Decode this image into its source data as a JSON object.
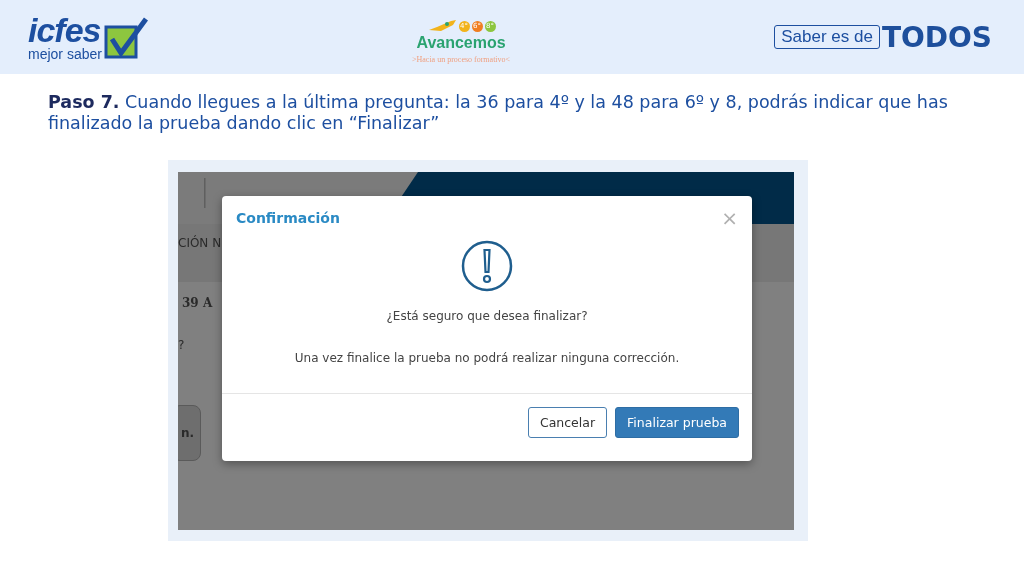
{
  "header": {
    "left_logo": {
      "name": "icfes",
      "tagline": "mejor saber"
    },
    "center_logo": {
      "grades": [
        "4°",
        "6°",
        "8°"
      ],
      "name": "Avancemos",
      "tagline": ">Hacia un proceso formativo<"
    },
    "right_logo": {
      "prefix": "Saber es de",
      "word": "TODOS"
    }
  },
  "instruction": "**Paso 7.** Cuando llegues a la última pregunta: la 36 para 4º y la 48 para 6º y 8, podrás indicar que has finalizado la prueba dando clic en “Finalizar”",
  "screenshot": {
    "background_texts": [
      "CIÓN N",
      "39 A",
      "?",
      "n."
    ],
    "dialog": {
      "title": "Confirmación",
      "close": "×",
      "question": "¿Está seguro que desea finalizar?",
      "message": "Una vez finalice la prueba no podrá realizar ninguna corrección.",
      "buttons": [
        {
          "label": "Cancelar",
          "kind": "secondary"
        },
        {
          "label": "Finalizar prueba",
          "kind": "primary"
        }
      ]
    }
  }
}
